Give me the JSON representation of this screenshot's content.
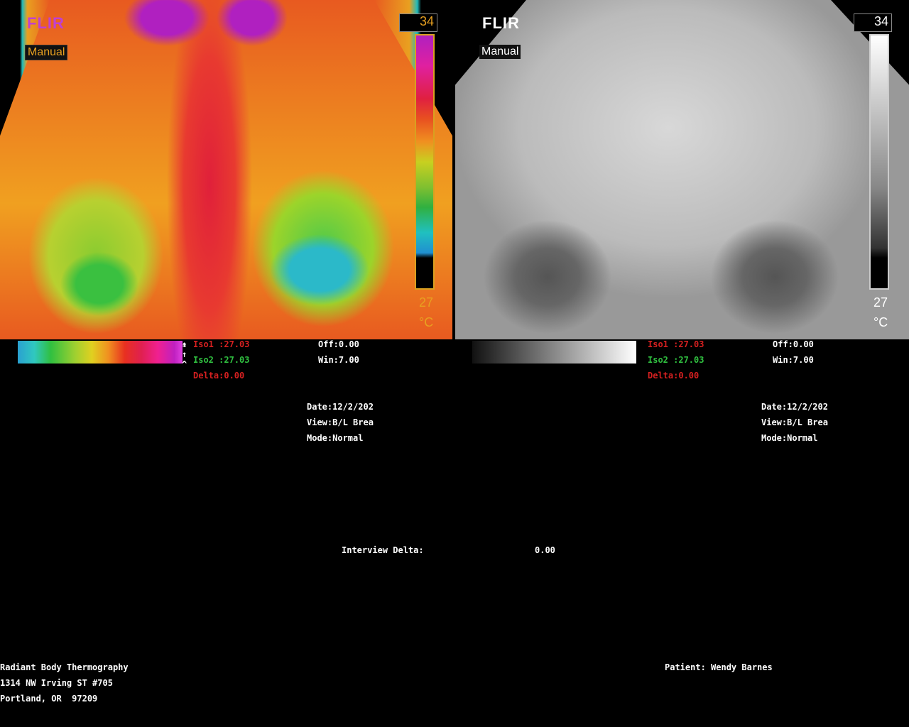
{
  "left_panel": {
    "brand": "FLIR",
    "mode_badge": "Manual",
    "scale_max": "34",
    "scale_min": "27",
    "unit": "°C",
    "iso1": "Iso1 :27.03",
    "iso2": "Iso2 :27.03",
    "delta": "Delta:0.00",
    "offset": "Off:0.00",
    "window": "Win:7.00",
    "date": "Date:12/2/202",
    "view": "View:B/L Brea",
    "mode": "Mode:Normal"
  },
  "right_panel": {
    "brand": "FLIR",
    "mode_badge": "Manual",
    "scale_max": "34",
    "scale_min": "27",
    "unit": "°C",
    "iso1": "Iso1 :27.03",
    "iso2": "Iso2 :27.03",
    "delta": "Delta:0.00",
    "offset": "Off:0.00",
    "window": "Win:7.00",
    "date": "Date:12/2/202",
    "view": "View:B/L Brea",
    "mode": "Mode:Normal"
  },
  "interview_delta": {
    "label": "Interview Delta:",
    "value": "0.00"
  },
  "clinic": {
    "name": "Radiant Body Thermography",
    "address1": "1314 NW Irving ST #705",
    "address2": "Portland, OR  97209"
  },
  "patient": "Patient: Wendy Barnes",
  "colors": {
    "iso1": "#d62020",
    "iso2": "#30c040",
    "delta": "#d62020"
  }
}
